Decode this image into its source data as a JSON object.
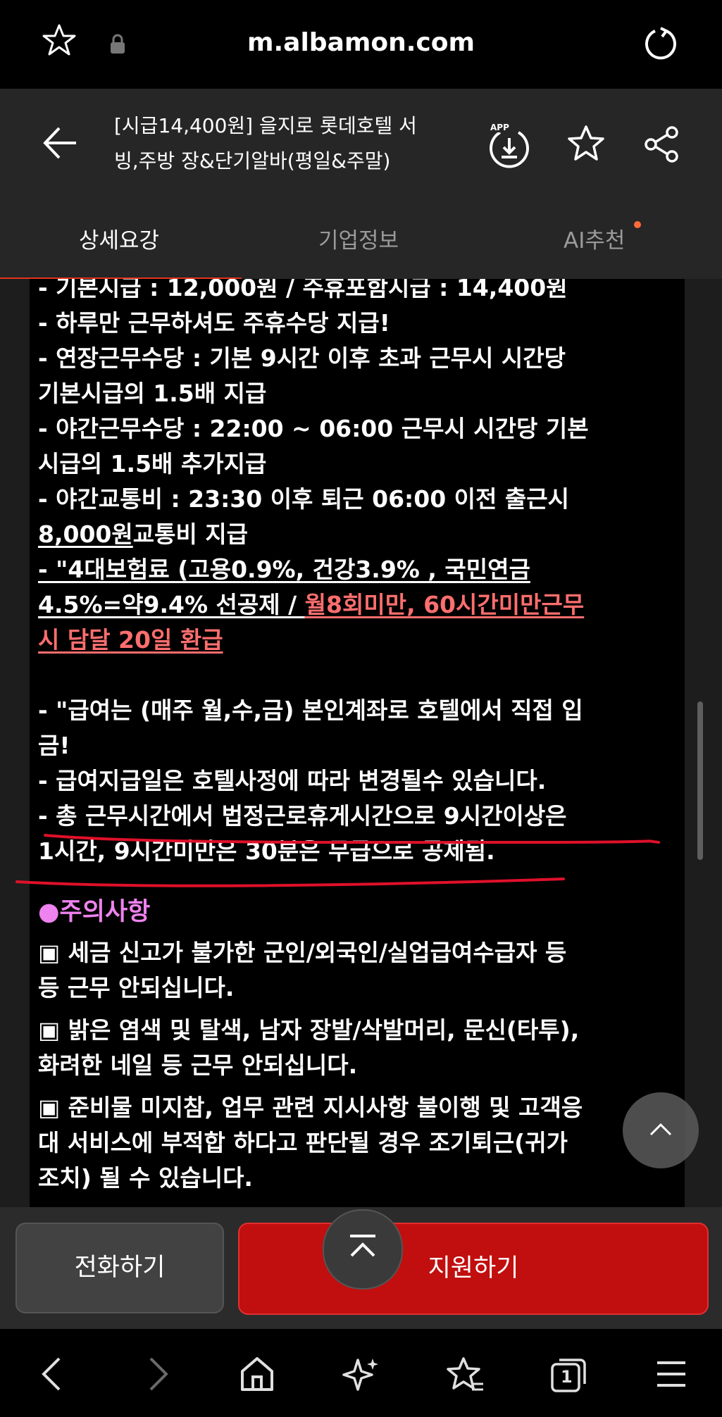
{
  "browser": {
    "url": "m.albamon.com"
  },
  "header": {
    "title_line1": "[시급14,400원] 을지로 롯데호텔 서",
    "title_line2": "빙,주방 장&단기알바(평일&주말)",
    "app_badge": "APP",
    "tabs": [
      "상세요강",
      "기업정보",
      "AI추천"
    ],
    "active_tab": "상세요강",
    "accent_color": "#e4331f"
  },
  "content": {
    "lines": [
      "- 기본시급 : 12,000원 / 주휴포함시급 : 14,400원",
      "- 하루만 근무하셔도 주휴수당 지급!",
      "- 연장근무수당 : 기본 9시간 이후 초과 근무시 시간당",
      "기본시급의 1.5배 지급",
      "- 야간근무수당 : 22:00 ~ 06:00 근무시 시간당 기본",
      "시급의 1.5배 추가지급",
      "- 야간교통비 : 23:30 이후 퇴근 06:00 이전 출근시"
    ],
    "transport_amount": "8,000원",
    "transport_rest": "교통비 지급",
    "insurance_line1": "- \"4대보험료 (고용0.9%, 건강3.9% , 국민연금",
    "insurance_line2_white": "4.5%=약9.4% 선공제 / ",
    "insurance_line2_red": "월8회미만, 60시간미만근무",
    "insurance_line3_red": "시 담달 20일 환급",
    "pay_line1": "- \"급여는 (매주 월,수,금) 본인계좌로 호텔에서 직접 입",
    "pay_line2": "금!",
    "pay_line3": "- 급여지급일은 호텔사정에 따라 변경될수 있습니다.",
    "break_line1": "- 총 근무시간에서 법정근로휴게시간으로 9시간이상은",
    "break_line2": "1시간, 9시간미만은 30분은 무급으로 공제됨.",
    "caution_title": "●주의사항",
    "caution_items": [
      "▣ 세금 신고가 불가한 군인/외국인/실업급여수급자 등",
      "등 근무 안되십니다.",
      "▣ 밝은 염색 및 탈색, 남자 장발/삭발머리, 문신(타투),",
      "화려한 네일 등 근무 안되십니다.",
      "▣ 준비물 미지참, 업무 관련 지시사항 불이행 및 고객응",
      "대 서비스에 부적합 하다고 판단될 경우 조기퇴근(귀가",
      "조치) 될 수 있습니다."
    ]
  },
  "actions": {
    "call_label": "전화하기",
    "apply_label": "지원하기",
    "apply_color": "#c10e0e"
  },
  "nav": {
    "tabs_count": "1"
  }
}
